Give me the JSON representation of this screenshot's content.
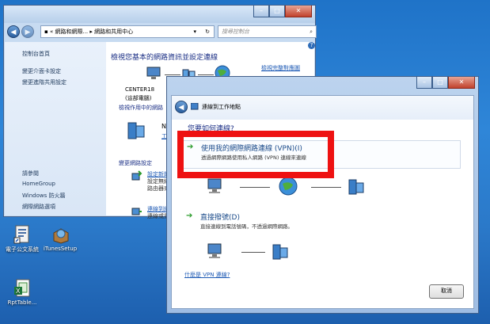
{
  "desktop": {
    "icons": [
      {
        "label": "電子公文系統",
        "icon": "document-shortcut-icon"
      },
      {
        "label": "iTunesSetup",
        "icon": "installer-icon"
      },
      {
        "label": "RptTable...",
        "icon": "excel-file-icon"
      }
    ]
  },
  "network_center": {
    "breadcrumb": [
      "網路和網際...",
      "網路和共用中心"
    ],
    "search_placeholder": "搜尋控制台",
    "sidebar": {
      "items": [
        "控制台首頁",
        "變更介面卡設定",
        "變更進階共用設定"
      ],
      "see_also_heading": "請參閱",
      "see_also": [
        "HomeGroup",
        "Windows 防火牆",
        "網際網路選項"
      ]
    },
    "heading": "檢視您基本的網路資訊並設定連線",
    "view_full_map": "檢視完整對應圖",
    "computer_name": "CENTER18",
    "computer_sub": "(這部電腦)",
    "active_networks_label": "檢視作用中的網路",
    "network_name": "NO",
    "network_sub": "工",
    "change_settings_heading": "變更網路設定",
    "change_items": [
      {
        "title": "設定新的",
        "line2": "設定無線",
        "line3": "路由器或"
      },
      {
        "title": "連線到網",
        "line2": "連線或重"
      }
    ]
  },
  "connect_wizard": {
    "title": "連線到工作地點",
    "question": "您要如何連線?",
    "options": [
      {
        "title": "使用我的網際網路連線 (VPN)(I)",
        "desc": "透過網際網路使用私人網路 (VPN) 連線來連線"
      },
      {
        "title": "直接撥號(D)",
        "desc": "直接連線到電話號碼，不透過網際網路。"
      }
    ],
    "what_is_vpn": "什麼是 VPN 連線?",
    "cancel_label": "取消"
  },
  "colors": {
    "highlight": "#ee1111",
    "link": "#1f5bb5",
    "accent": "#2c9c2c"
  }
}
